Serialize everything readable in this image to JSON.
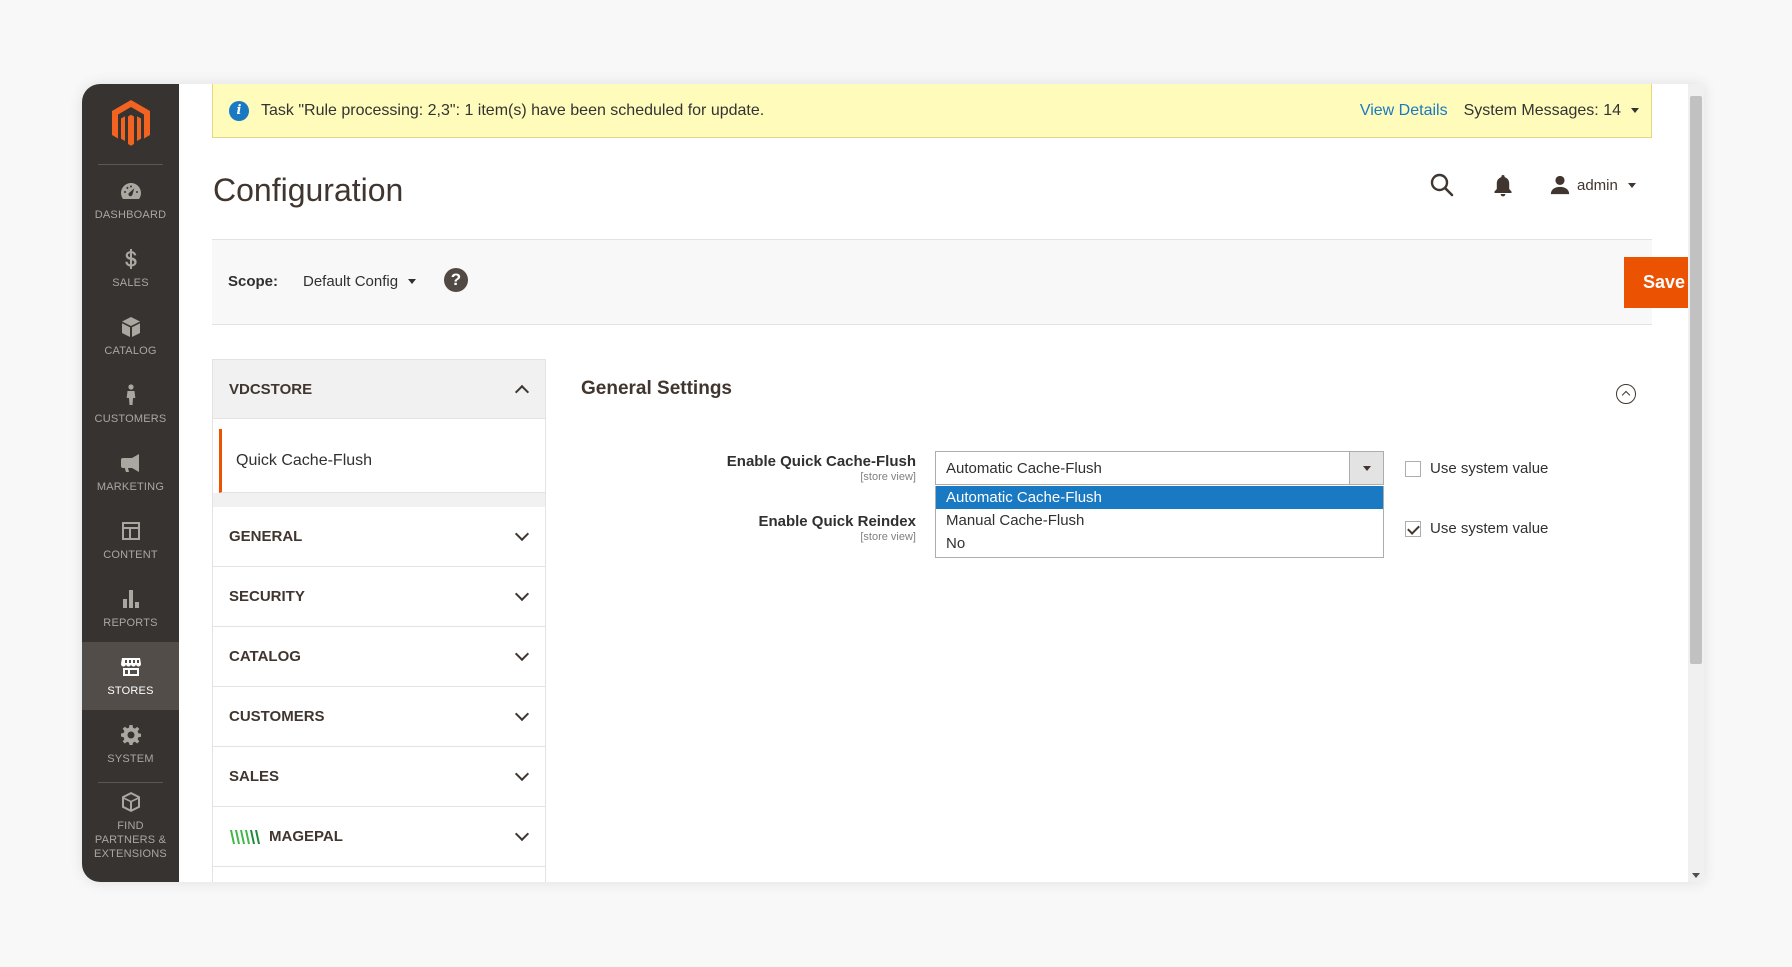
{
  "sidebar": {
    "items": [
      {
        "label": "DASHBOARD",
        "icon": "dashboard-icon"
      },
      {
        "label": "SALES",
        "icon": "dollar-icon"
      },
      {
        "label": "CATALOG",
        "icon": "box-icon"
      },
      {
        "label": "CUSTOMERS",
        "icon": "person-icon"
      },
      {
        "label": "MARKETING",
        "icon": "megaphone-icon"
      },
      {
        "label": "CONTENT",
        "icon": "layout-icon"
      },
      {
        "label": "REPORTS",
        "icon": "bar-chart-icon"
      },
      {
        "label": "STORES",
        "icon": "storefront-icon"
      },
      {
        "label": "SYSTEM",
        "icon": "gear-icon"
      },
      {
        "label": "FIND PARTNERS & EXTENSIONS",
        "icon": "extension-box-icon"
      }
    ],
    "active": "STORES"
  },
  "notice": {
    "text": "Task \"Rule processing: 2,3\": 1 item(s) have been scheduled for update.",
    "view_details": "View Details",
    "system_messages": "System Messages: 14"
  },
  "header": {
    "title": "Configuration",
    "user": "admin"
  },
  "scope": {
    "label": "Scope:",
    "value": "Default Config",
    "save_label": "Save Config"
  },
  "config_nav": {
    "open_section": "VDCSTORE",
    "open_item": "Quick Cache-Flush",
    "sections": [
      "GENERAL",
      "SECURITY",
      "CATALOG",
      "CUSTOMERS",
      "SALES",
      "MAGEPAL"
    ]
  },
  "main": {
    "group_title": "General Settings",
    "fields": [
      {
        "label": "Enable Quick Cache-Flush",
        "scope": "[store view]",
        "value": "Automatic Cache-Flush",
        "use_system_value": false,
        "use_system_label": "Use system value"
      },
      {
        "label": "Enable Quick Reindex",
        "scope": "[store view]",
        "use_system_value": true,
        "use_system_label": "Use system value"
      }
    ],
    "dropdown_options": [
      "Automatic Cache-Flush",
      "Manual Cache-Flush",
      "No"
    ],
    "dropdown_selected": "Automatic Cache-Flush"
  },
  "colors": {
    "sidebar_bg": "#373330",
    "accent": "#eb5202",
    "link": "#1979c3",
    "notice_bg": "#fffbbb"
  }
}
